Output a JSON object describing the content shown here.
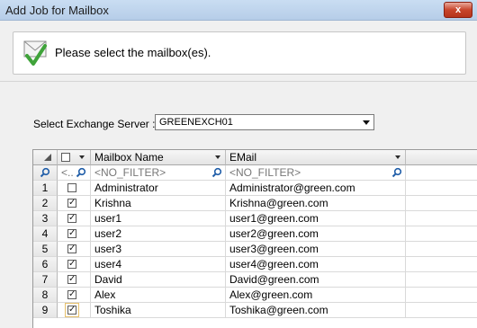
{
  "window": {
    "title": "Add Job for Mailbox",
    "close_glyph": "x"
  },
  "banner": {
    "text": "Please select the mailbox(es).",
    "icon": "mailbox-check-icon"
  },
  "server": {
    "label": "Select Exchange Server :",
    "value": "GREENEXCH01"
  },
  "grid": {
    "columns": {
      "name": "Mailbox Name",
      "email": "EMail"
    },
    "filter": {
      "select": "<..",
      "name": "<NO_FILTER>",
      "email": "<NO_FILTER>"
    },
    "rows": [
      {
        "num": "1",
        "checked": false,
        "name": "Administrator",
        "email": "Administrator@green.com"
      },
      {
        "num": "2",
        "checked": true,
        "name": "Krishna",
        "email": "Krishna@green.com"
      },
      {
        "num": "3",
        "checked": true,
        "name": "user1",
        "email": "user1@green.com"
      },
      {
        "num": "4",
        "checked": true,
        "name": "user2",
        "email": "user2@green.com"
      },
      {
        "num": "5",
        "checked": true,
        "name": "user3",
        "email": "user3@green.com"
      },
      {
        "num": "6",
        "checked": true,
        "name": "user4",
        "email": "user4@green.com"
      },
      {
        "num": "7",
        "checked": true,
        "name": "David",
        "email": "David@green.com"
      },
      {
        "num": "8",
        "checked": true,
        "name": "Alex",
        "email": "Alex@green.com"
      },
      {
        "num": "9",
        "checked": true,
        "name": "Toshika",
        "email": "Toshika@green.com"
      }
    ]
  },
  "colors": {
    "titlebar": "#c9ddf2",
    "close": "#c8452c",
    "check_green": "#3fa33a"
  }
}
